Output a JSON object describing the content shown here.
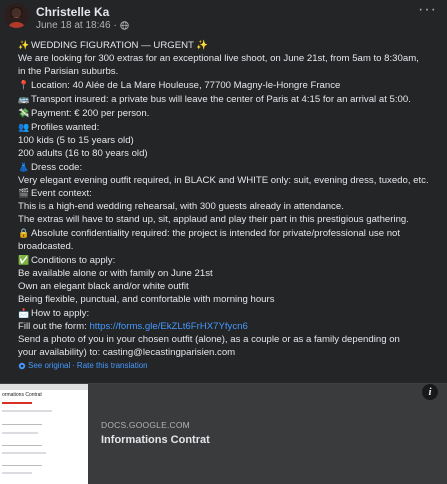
{
  "header": {
    "author": "Christelle Ka",
    "timestamp": "June 18 at 18:46",
    "separator": "·",
    "more_label": "···"
  },
  "post": {
    "lines": [
      {
        "icon": "✨",
        "text": "WEDDING FIGURATION — URGENT ✨"
      },
      {
        "icon": "",
        "text": "We are looking for 300 extras for an exceptional live shoot, on June 21st, from 5am to 8:30am,"
      },
      {
        "icon": "",
        "text": "in the Parisian suburbs."
      },
      {
        "icon": "📍",
        "text": "Location: 40 Alée de La Mare Houleuse, 77700 Magny-le-Hongre France"
      },
      {
        "icon": "🚌",
        "text": "Transport insured: a private bus will leave the center of Paris at 4:15 for an arrival at 5:00."
      },
      {
        "icon": "💸",
        "text": "Payment: € 200 per person."
      },
      {
        "icon": "👥",
        "text": "Profiles wanted:"
      },
      {
        "icon": "",
        "text": "100 kids (5 to 15 years old)"
      },
      {
        "icon": "",
        "text": "200 adults (16 to 80 years old)"
      },
      {
        "icon": "👗",
        "text": "Dress code:"
      },
      {
        "icon": "",
        "text": "Very elegant evening outfit required, in BLACK and WHITE only: suit, evening dress, tuxedo, etc."
      },
      {
        "icon": "🎬",
        "text": "Event context:"
      },
      {
        "icon": "",
        "text": "This is a high-end wedding rehearsal, with 300 guests already in attendance."
      },
      {
        "icon": "",
        "text": "The extras will have to stand up, sit, applaud and play their part in this prestigious gathering."
      },
      {
        "icon": "🔒",
        "text": "Absolute confidentiality required: the project is intended for private/professional use not"
      },
      {
        "icon": "",
        "text": "broadcasted."
      },
      {
        "icon": "✅",
        "text": "Conditions to apply:"
      },
      {
        "icon": "",
        "text": "Be available alone or with family on June 21st"
      },
      {
        "icon": "",
        "text": "Own an elegant black and/or white outfit"
      },
      {
        "icon": "",
        "text": "Being flexible, punctual, and comfortable with morning hours"
      },
      {
        "icon": "📩",
        "text": "How to apply:"
      }
    ],
    "apply_prefix": "Fill out the form: ",
    "apply_link": "https://forms.gle/EkZLt6FrHX7Yfycn6",
    "tail_lines": [
      "Send a photo of you in your chosen outfit (alone), as a couple or as a family depending on",
      "your availability) to: casting@lecastingparisien.com"
    ]
  },
  "translation": {
    "see_original": "See original",
    "dot": "·",
    "rate": "Rate this translation"
  },
  "link_preview": {
    "domain": "DOCS.GOOGLE.COM",
    "title": "Informations Contrat",
    "thumb_title": "ormations Contrat",
    "info_label": "i"
  },
  "colors": {
    "background": "#242526",
    "text": "#e4e6eb",
    "secondary": "#b0b3b8",
    "link": "#4599ff",
    "card": "#3a3b3c"
  }
}
